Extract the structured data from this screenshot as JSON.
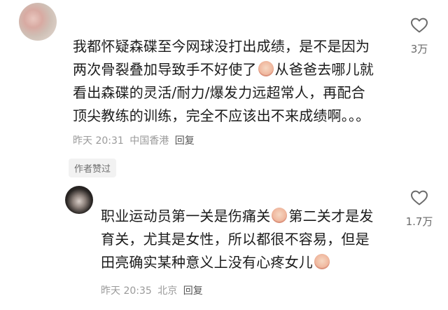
{
  "comments": [
    {
      "lines": [
        "我都怀疑森碟至今网球没打出成绩，是不是因为",
        "两次骨裂叠加导致手不好使了",
        "从爸爸去哪儿就",
        "看出森碟的灵活/耐力/爆发力远超常人，再配合",
        "顶尖教练的训练，完全不应该出不来成绩啊。。。"
      ],
      "time": "昨天 20:31",
      "location": "中国香港",
      "reply_label": "回复",
      "likes": "3万",
      "badge": "作者赞过"
    },
    {
      "lines": [
        "职业运动员第一关是伤痛关",
        "第二关才是发",
        "育关，尤其是女性，所以都很不容易，但是",
        "田亮确实某种意义上没有心疼女儿"
      ],
      "time": "昨天 20:35",
      "location": "北京",
      "reply_label": "回复",
      "likes": "1.7万"
    }
  ],
  "colors": {
    "text": "#1b1b1b",
    "meta": "#9a9a9a",
    "badge_bg": "#f2f2f2"
  },
  "icons": [
    "heart-outline-icon",
    "crying-face-emoji",
    "peach-face-emoji"
  ]
}
